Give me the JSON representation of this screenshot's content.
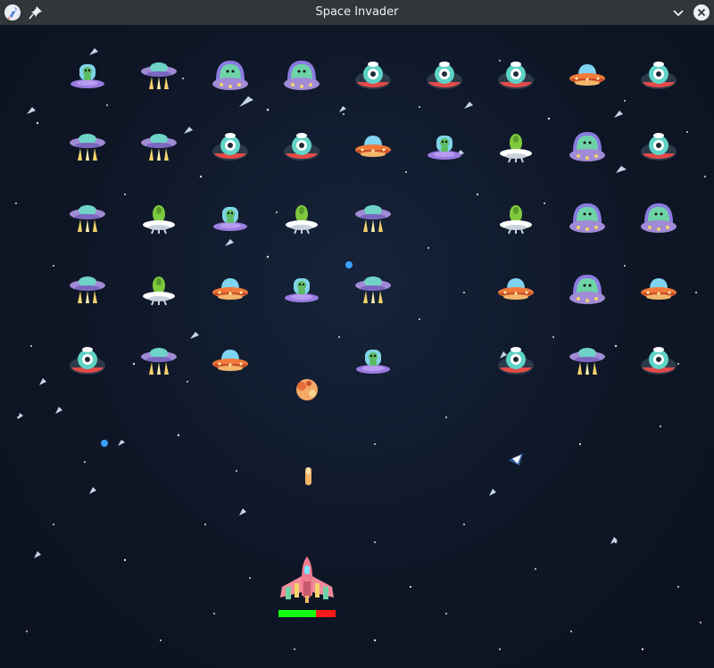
{
  "window": {
    "title": "Space Invader"
  },
  "colors": {
    "titlebar": "#31363b",
    "space": "#0e1626",
    "health_good": "#12ff12",
    "health_lost": "#ff1a1a",
    "enemy_bullet": "#3aa0ff"
  },
  "icons": {
    "app": "rocket-app-icon",
    "pin": "pin-icon",
    "minimize": "chevron-down-icon",
    "close": "close-icon"
  },
  "game": {
    "player": {
      "health_fraction": 0.66
    },
    "enemy_grid": [
      [
        "purple-alien-saucer",
        "tripod-ufo",
        "dome-alien-ufo",
        "dome-alien-ufo",
        "eye-ufo",
        "eye-ufo",
        "eye-ufo",
        "orange-saucer",
        "eye-ufo"
      ],
      [
        "tripod-ufo",
        "tripod-ufo",
        "eye-ufo",
        "eye-ufo",
        "orange-saucer",
        "purple-alien-saucer",
        "white-saucer-green-alien",
        "dome-alien-ufo",
        "eye-ufo"
      ],
      [
        "tripod-ufo",
        "white-saucer-green-alien",
        "purple-alien-saucer",
        "white-saucer-green-alien",
        "tripod-ufo",
        "",
        "white-saucer-green-alien",
        "dome-alien-ufo",
        "dome-alien-ufo"
      ],
      [
        "tripod-ufo",
        "white-saucer-green-alien",
        "orange-saucer",
        "purple-alien-saucer",
        "tripod-ufo",
        "",
        "orange-saucer",
        "dome-alien-ufo",
        "orange-saucer"
      ],
      [
        "eye-ufo",
        "tripod-ufo",
        "orange-saucer",
        "",
        "purple-alien-saucer",
        "",
        "eye-ufo",
        "tripod-ufo",
        "eye-ufo"
      ]
    ]
  }
}
